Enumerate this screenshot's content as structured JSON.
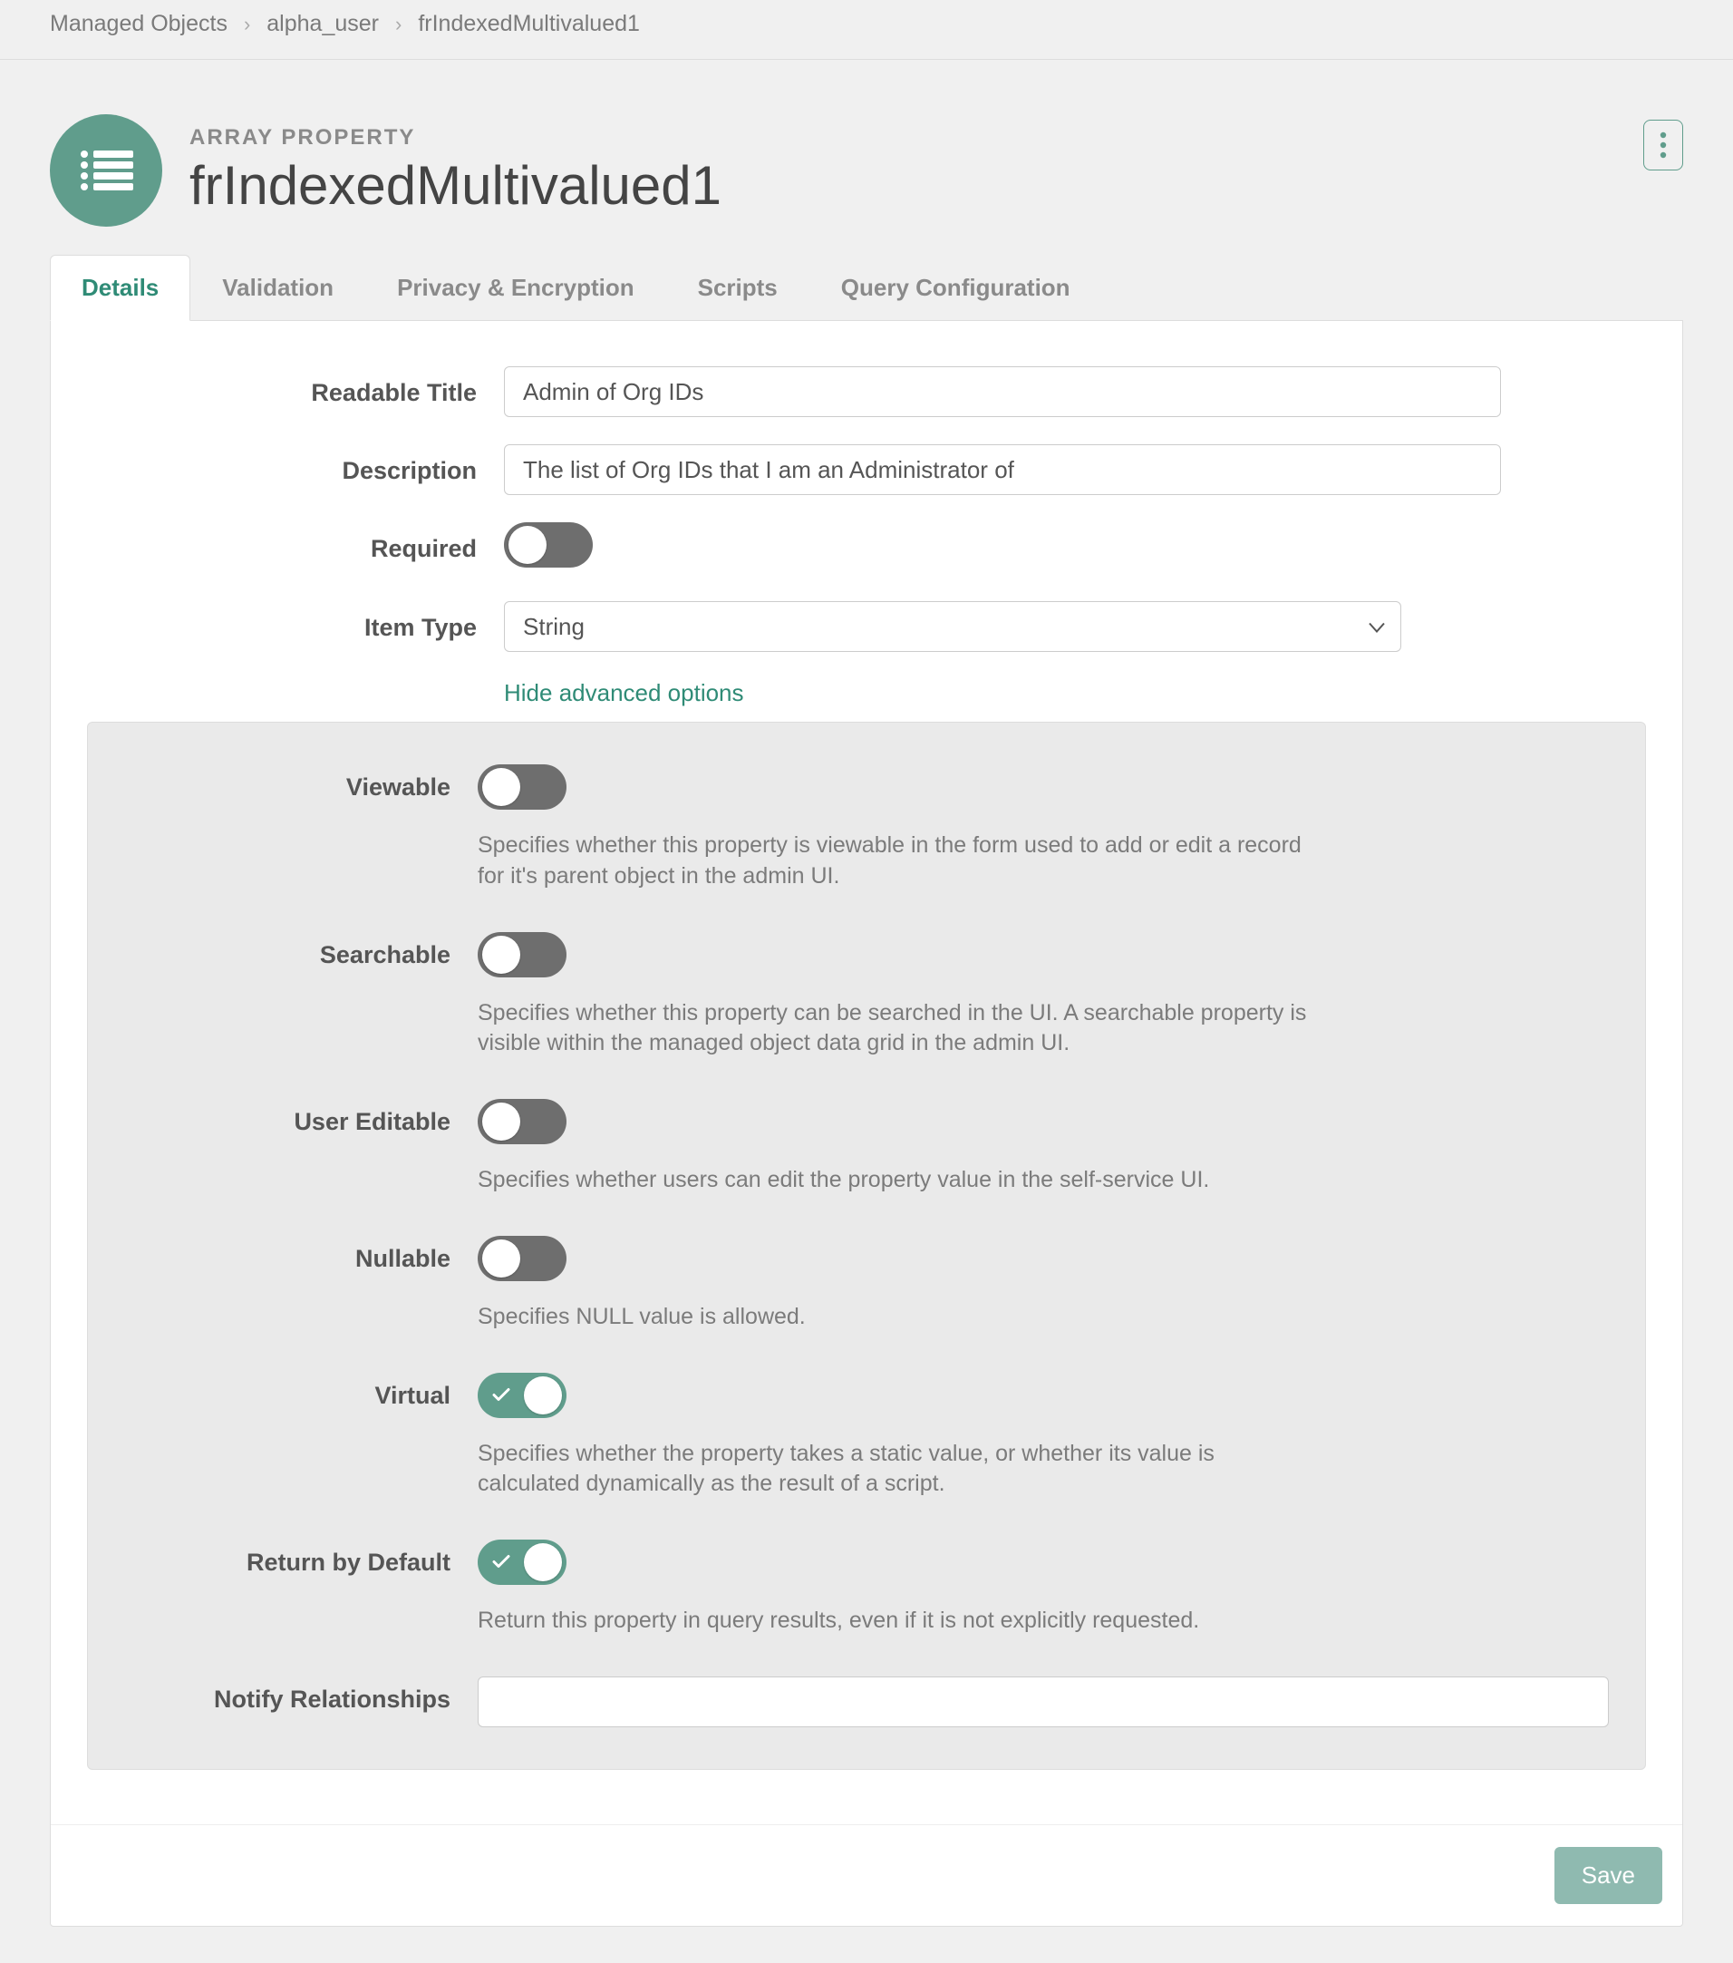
{
  "breadcrumb": {
    "items": [
      "Managed Objects",
      "alpha_user",
      "frIndexedMultivalued1"
    ]
  },
  "header": {
    "kicker": "ARRAY PROPERTY",
    "title": "frIndexedMultivalued1"
  },
  "tabs": [
    {
      "label": "Details",
      "active": true
    },
    {
      "label": "Validation",
      "active": false
    },
    {
      "label": "Privacy & Encryption",
      "active": false
    },
    {
      "label": "Scripts",
      "active": false
    },
    {
      "label": "Query Configuration",
      "active": false
    }
  ],
  "form": {
    "readable_title_label": "Readable Title",
    "readable_title_value": "Admin of Org IDs",
    "description_label": "Description",
    "description_value": "The list of Org IDs that I am an Administrator of",
    "required_label": "Required",
    "required_on": false,
    "item_type_label": "Item Type",
    "item_type_value": "String",
    "item_type_options": [
      "String"
    ],
    "advanced_toggle_text": "Hide advanced options",
    "advanced": {
      "viewable": {
        "label": "Viewable",
        "on": false,
        "help": "Specifies whether this property is viewable in the form used to add or edit a record for it's parent object in the admin UI."
      },
      "searchable": {
        "label": "Searchable",
        "on": false,
        "help": "Specifies whether this property can be searched in the UI. A searchable property is visible within the managed object data grid in the admin UI."
      },
      "user_editable": {
        "label": "User Editable",
        "on": false,
        "help": "Specifies whether users can edit the property value in the self-service UI."
      },
      "nullable": {
        "label": "Nullable",
        "on": false,
        "help": "Specifies NULL value is allowed."
      },
      "virtual": {
        "label": "Virtual",
        "on": true,
        "help": "Specifies whether the property takes a static value, or whether its value is calculated dynamically as the result of a script."
      },
      "return_by_default": {
        "label": "Return by Default",
        "on": true,
        "help": "Return this property in query results, even if it is not explicitly requested."
      },
      "notify_relationships": {
        "label": "Notify Relationships",
        "value": ""
      }
    }
  },
  "footer": {
    "save_label": "Save"
  }
}
